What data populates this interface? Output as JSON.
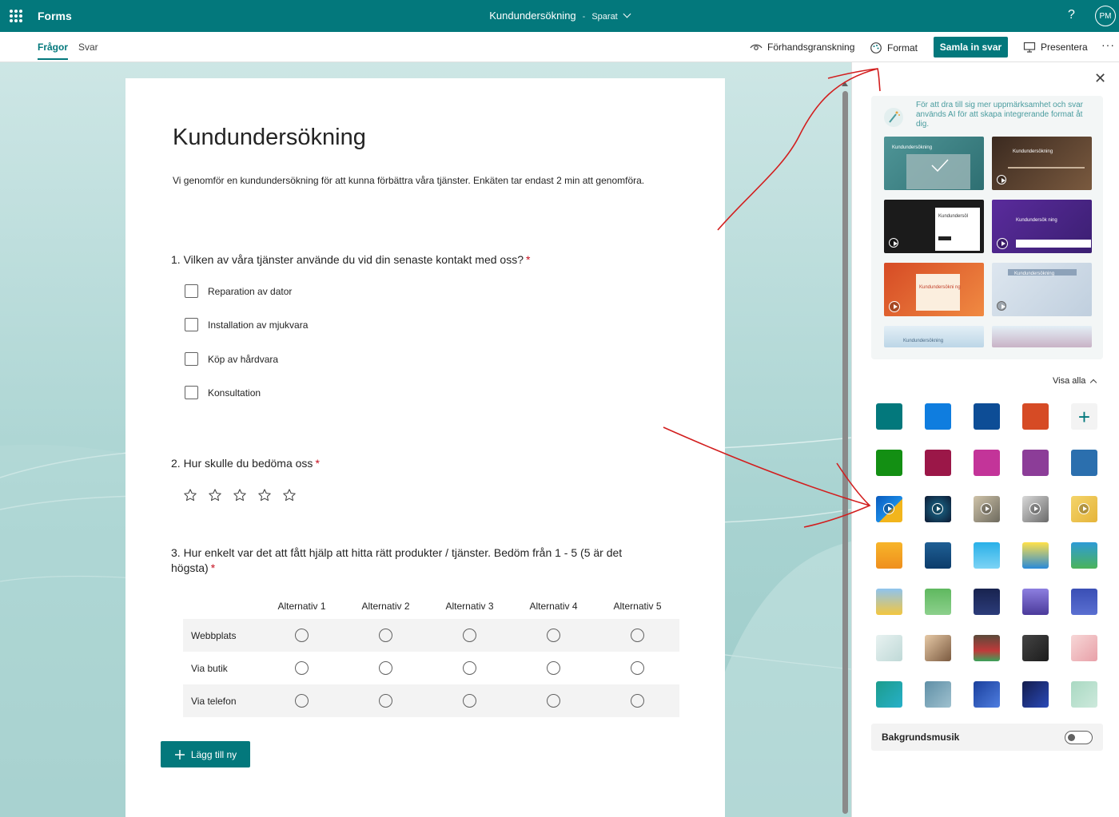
{
  "app": {
    "name": "Forms",
    "doc_title": "Kundundersökning",
    "save_status": "Sparat",
    "avatar_initials": "PM",
    "help": "?"
  },
  "tabs": [
    {
      "label": "Frågor",
      "active": true
    },
    {
      "label": "Svar",
      "active": false
    }
  ],
  "commands": {
    "preview": "Förhandsgranskning",
    "format": "Format",
    "collect": "Samla in svar",
    "present": "Presentera",
    "more": "···"
  },
  "form": {
    "title": "Kundundersökning",
    "description": "Vi genomför en kundundersökning för att kunna förbättra våra tjänster. Enkäten tar endast 2 min att genomföra.",
    "questions": [
      {
        "text": "1. Vilken av våra tjänster använde du vid din senaste kontakt med oss?",
        "required": "*",
        "options": [
          "Reparation av dator",
          "Installation av mjukvara",
          "Köp av hårdvara",
          "Konsultation"
        ]
      },
      {
        "text": "2. Hur skulle du bedöma oss",
        "required": "*",
        "stars": 5
      },
      {
        "text": "3. Hur enkelt var det att fått hjälp att hitta rätt produkter / tjänster. Bedöm från 1 - 5 (5 är det högsta)",
        "required": "*",
        "columns": [
          "Alternativ 1",
          "Alternativ 2",
          "Alternativ 3",
          "Alternativ 4",
          "Alternativ 5"
        ],
        "rows": [
          "Webbplats",
          "Via butik",
          "Via telefon"
        ]
      }
    ],
    "add_new": "Lägg till ny"
  },
  "panel": {
    "ai_text": "För att dra till sig mer uppmärksamhet och svar används AI för att skapa integrerande format åt dig.",
    "thumb_labels": [
      "Kundundersökning",
      "Kundundersökning",
      "Kundundersöl",
      "Kundundersök ning",
      "Kundundersökni ng",
      "Kundundersökning",
      "Kundundersökning"
    ],
    "show_all": "Visa alla",
    "background_music": "Bakgrundsmusik",
    "background_music_on": false,
    "swatch_colors": [
      "#03787c",
      "#0f7ddf",
      "#0d4d96",
      "#d64b25",
      "#138f13",
      "#9b1748",
      "#c33499",
      "#8c3d98",
      "#2b6fae"
    ]
  },
  "colors": {
    "brand": "#03787c",
    "required": "#c50f1f",
    "annotation": "#d21e1e"
  }
}
